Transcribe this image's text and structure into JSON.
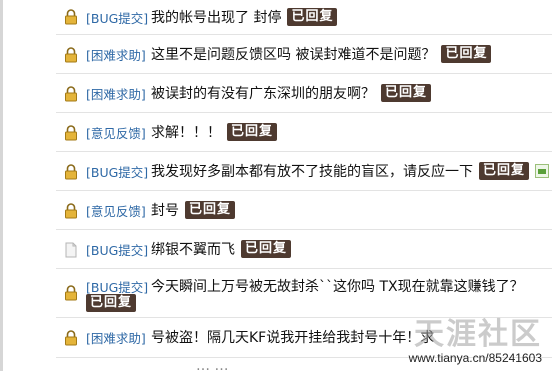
{
  "status_badge": "已回复",
  "rows": [
    {
      "icon": "lock-icon",
      "category": "[BUG提交]",
      "title": "我的帐号出现了 封停",
      "replied": true
    },
    {
      "icon": "lock-icon",
      "category": "[困难求助]",
      "title": "这里不是问题反馈区吗 被误封难道不是问题？",
      "replied": true
    },
    {
      "icon": "lock-icon",
      "category": "[困难求助]",
      "title": "被误封的有没有广东深圳的朋友啊？",
      "replied": true
    },
    {
      "icon": "lock-icon",
      "category": "[意见反馈]",
      "title": "求解！！！",
      "replied": true
    },
    {
      "icon": "lock-icon",
      "category": "[BUG提交]",
      "title": "我发现好多副本都有放不了技能的盲区，请反应一下",
      "replied": true,
      "has_image": true
    },
    {
      "icon": "lock-icon",
      "category": "[意见反馈]",
      "title": "封号",
      "replied": true
    },
    {
      "icon": "document-icon",
      "category": "[BUG提交]",
      "title": "绑银不翼而飞",
      "replied": true
    },
    {
      "icon": "lock-icon",
      "category": "[BUG提交]",
      "title": "今天瞬间上万号被无故封杀``这你吗 TX现在就靠这赚钱了？",
      "replied": true
    },
    {
      "icon": "lock-icon",
      "category": "[困难求助]",
      "title": "号被盗！隔几天KF说我开挂给我封号十年！求",
      "replied": false
    }
  ],
  "partial_row": {
    "title": "… …"
  },
  "watermark": {
    "logo": "天涯社区",
    "url": "www.tianya.cn/85241603"
  },
  "colors": {
    "category": "#2f69a6",
    "badge_bg": "#4e3a30",
    "lock": "#d2a22a"
  }
}
